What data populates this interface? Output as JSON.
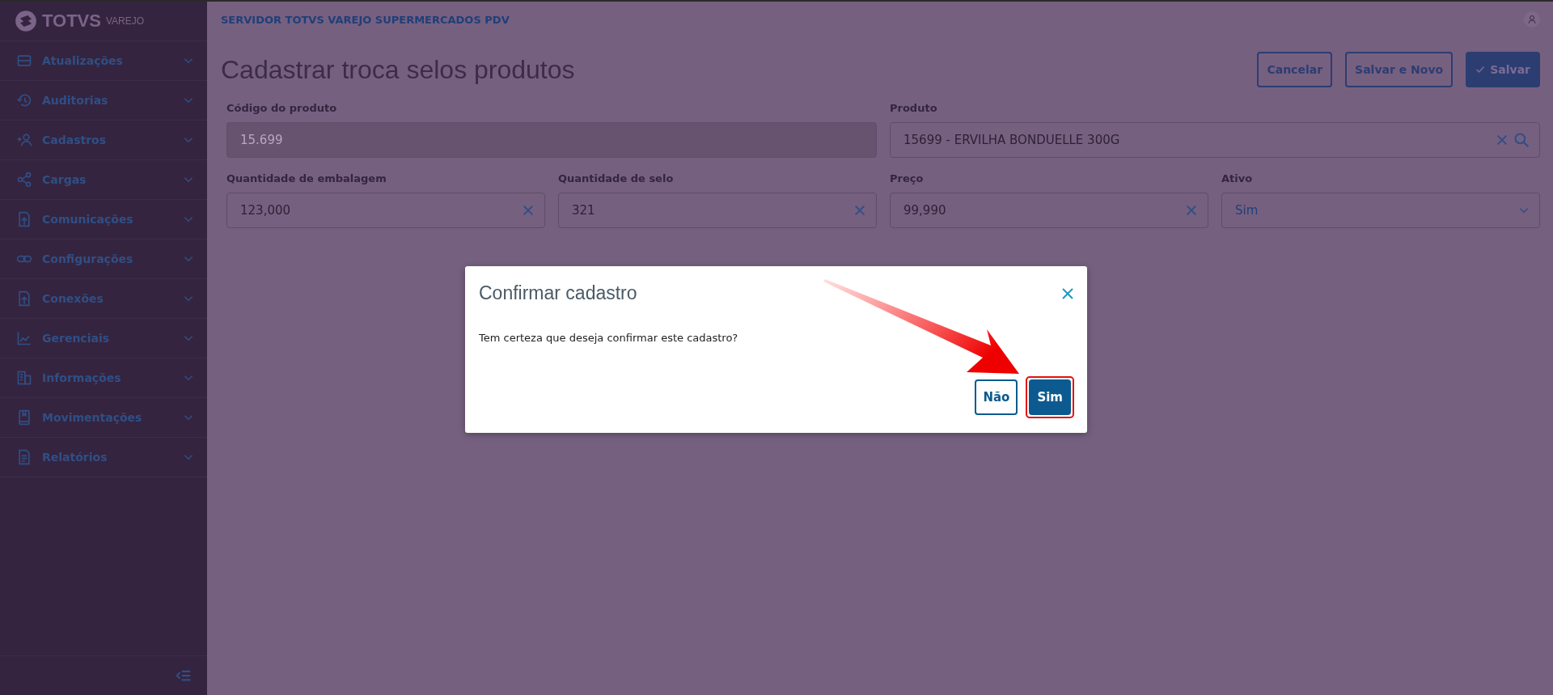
{
  "sidebar": {
    "logo": {
      "brand": "TOTVS",
      "product": "VAREJO"
    },
    "items": [
      {
        "label": "Atualizações"
      },
      {
        "label": "Auditorias"
      },
      {
        "label": "Cadastros"
      },
      {
        "label": "Cargas"
      },
      {
        "label": "Comunicações"
      },
      {
        "label": "Configurações"
      },
      {
        "label": "Conexões"
      },
      {
        "label": "Gerenciais"
      },
      {
        "label": "Informações"
      },
      {
        "label": "Movimentações"
      },
      {
        "label": "Relatórios"
      }
    ]
  },
  "header": {
    "title": "SERVIDOR TOTVS VAREJO SUPERMERCADOS PDV"
  },
  "page": {
    "title": "Cadastrar troca selos produtos",
    "actions": [
      {
        "label": "Cancelar",
        "kind": "secondary"
      },
      {
        "label": "Salvar e Novo",
        "kind": "secondary"
      },
      {
        "label": "Salvar",
        "kind": "primary"
      }
    ],
    "fields": [
      {
        "label": "Código do produto",
        "value": "15.699",
        "kind": "text",
        "disabled": true
      },
      {
        "label": "Produto",
        "value": "15699 - ERVILHA BONDUELLE 300G",
        "kind": "lookup",
        "disabled": false
      },
      {
        "label": "Quantidade de embalagem",
        "value": "123,000",
        "kind": "clearable",
        "disabled": false
      },
      {
        "label": "Quantidade de selo",
        "value": "321",
        "kind": "clearable",
        "disabled": false
      },
      {
        "label": "Preço",
        "value": "99,990",
        "kind": "clearable",
        "disabled": false
      },
      {
        "label": "Ativo",
        "value": "Sim",
        "kind": "select",
        "disabled": false
      }
    ]
  },
  "dialog": {
    "title": "Confirmar cadastro",
    "message": "Tem certeza que deseja confirmar este cadastro?",
    "buttons": [
      {
        "label": "Não",
        "kind": "secondary",
        "highlighted": false
      },
      {
        "label": "Sim",
        "kind": "primary",
        "highlighted": true
      }
    ]
  }
}
